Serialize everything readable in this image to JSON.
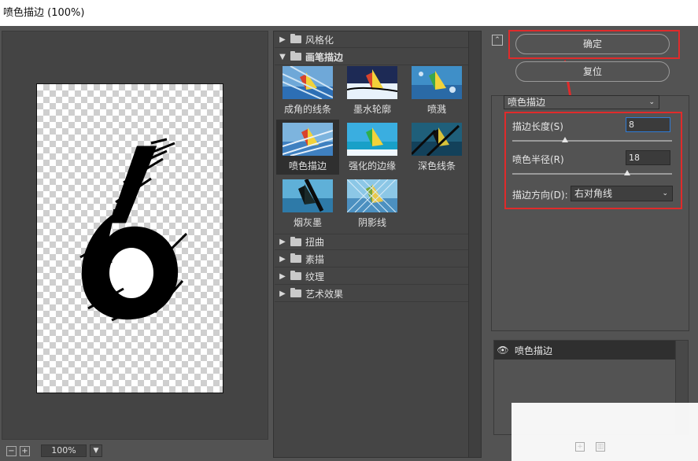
{
  "window": {
    "title": "喷色描边 (100%)"
  },
  "preview": {
    "zoom": "100%"
  },
  "gallery": {
    "categories": {
      "c0": "风格化",
      "c1": "画笔描边",
      "c2": "扭曲",
      "c3": "素描",
      "c4": "纹理",
      "c5": "艺术效果"
    },
    "thumbs": {
      "t0": "成角的线条",
      "t1": "墨水轮廓",
      "t2": "喷溅",
      "t3": "喷色描边",
      "t4": "强化的边缘",
      "t5": "深色线条",
      "t6": "烟灰墨",
      "t7": "阴影线"
    },
    "selected": "喷色描边"
  },
  "actions": {
    "ok_label": "确定",
    "reset_label": "复位"
  },
  "settings": {
    "filter_select": "喷色描边",
    "stroke_length_label": "描边长度(S)",
    "stroke_length_value": "8",
    "stroke_length_level": 0.33,
    "spray_radius_label": "喷色半径(R)",
    "spray_radius_value": "18",
    "spray_radius_level": 0.72,
    "direction_label": "描边方向(D):",
    "direction_value": "右对角线"
  },
  "layers": {
    "item0": "喷色描边"
  },
  "colors": {
    "highlight": "#e02b2b",
    "panel": "#535353",
    "active_field": "#2f7bd6"
  }
}
